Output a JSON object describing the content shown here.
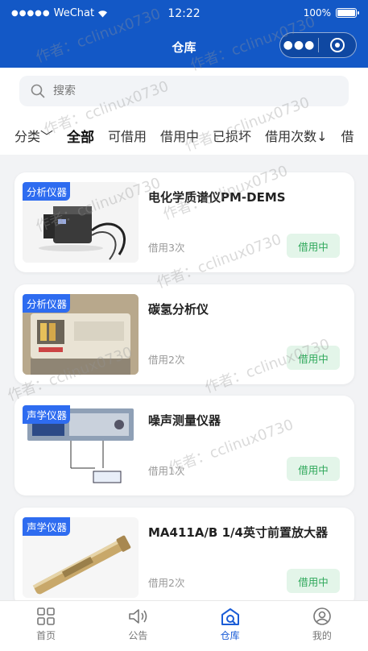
{
  "status_bar": {
    "carrier": "WeChat",
    "time": "12:22",
    "battery": "100%"
  },
  "nav": {
    "title": "仓库"
  },
  "search": {
    "placeholder": "搜索"
  },
  "filters": [
    {
      "label": "分类﹀"
    },
    {
      "label": "全部"
    },
    {
      "label": "可借用"
    },
    {
      "label": "借用中"
    },
    {
      "label": "已损坏"
    },
    {
      "label": "借用次数↓"
    },
    {
      "label": "借"
    }
  ],
  "items": [
    {
      "tag": "分析仪器",
      "name": "电化学质谱仪PM-DEMS",
      "count": "借用3次",
      "status": "借用中"
    },
    {
      "tag": "分析仪器",
      "name": "碳氢分析仪",
      "count": "借用2次",
      "status": "借用中"
    },
    {
      "tag": "声学仪器",
      "name": "噪声测量仪器",
      "count": "借用1次",
      "status": "借用中"
    },
    {
      "tag": "声学仪器",
      "name": "MA411A/B 1/4英寸前置放大器",
      "count": "借用2次",
      "status": "借用中"
    }
  ],
  "tabs": [
    {
      "label": "首页",
      "icon": "grid-icon"
    },
    {
      "label": "公告",
      "icon": "speaker-icon"
    },
    {
      "label": "仓库",
      "icon": "warehouse-icon"
    },
    {
      "label": "我的",
      "icon": "user-icon"
    }
  ],
  "watermark": "作者：cclinux0730",
  "colors": {
    "primary": "#1358c6",
    "tag": "#2e6cf0",
    "status_bg": "#e3f5e9",
    "status_text": "#2ea85a",
    "tab_indicator": "#f5a04a"
  }
}
